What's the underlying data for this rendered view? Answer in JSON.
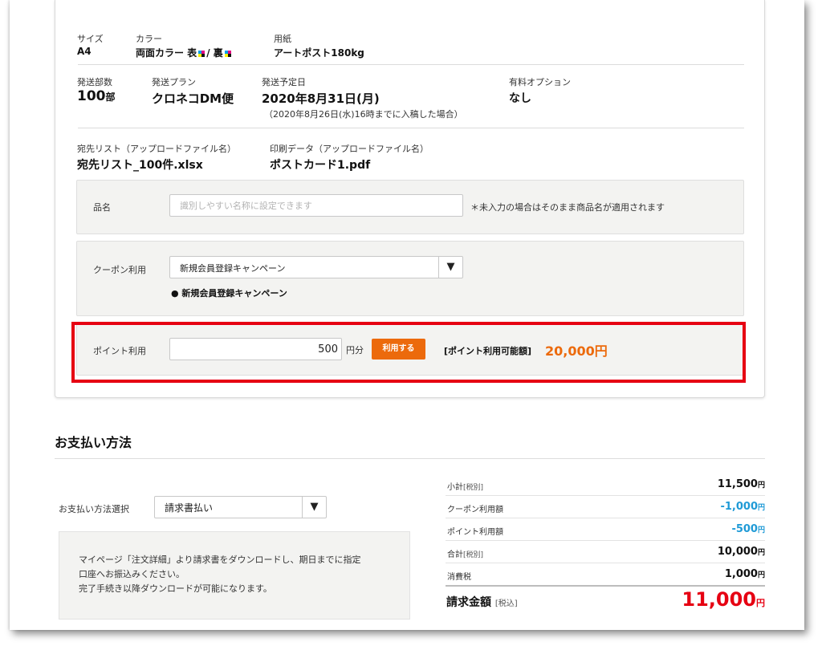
{
  "order": {
    "size_label": "サイズ",
    "size_value": "A4",
    "color_label": "カラー",
    "color_value_a": "両面カラー 表",
    "color_value_sep": "/ 裏",
    "paper_label": "用紙",
    "paper_value": "アートポスト180kg",
    "copies_label": "発送部数",
    "copies_value": "100",
    "copies_unit": "部",
    "plan_label": "発送プラン",
    "plan_value": "クロネコDM便",
    "ship_date_label": "発送予定日",
    "ship_date_value": "2020年8月31日(月)",
    "ship_date_note": "（2020年8月26日(水)16時までに入稿した場合）",
    "option_label": "有料オプション",
    "option_value": "なし",
    "address_list_label": "宛先リスト（アップロードファイル名）",
    "address_list_value": "宛先リスト_100件.xlsx",
    "print_data_label": "印刷データ（アップロードファイル名）",
    "print_data_value": "ポストカード1.pdf"
  },
  "product_name": {
    "label": "品名",
    "placeholder": "識別しやすい名称に設定できます",
    "note": "＊未入力の場合はそのまま商品名が適用されます"
  },
  "coupon": {
    "label": "クーポン利用",
    "selected": "新規会員登録キャンペーン",
    "arrow": "▼",
    "applied": "●  新規会員登録キャンペーン"
  },
  "points": {
    "label": "ポイント利用",
    "value": "500",
    "unit": "円分",
    "button": "利用する",
    "available_label": "[ポイント利用可能額]",
    "available_value": "20,000円"
  },
  "payment": {
    "title": "お支払い方法",
    "select_label": "お支払い方法選択",
    "selected": "請求書払い",
    "arrow": "▼",
    "note_line1": "マイページ「注文詳細」より請求書をダウンロードし、期日までに指定",
    "note_line2": "口座へお振込みください。",
    "note_line3": "完了手続き以降ダウンロードが可能になります。"
  },
  "summary": {
    "subtotal_label": "小計",
    "subtotal_tag": "[税別]",
    "subtotal_value": "11,500",
    "coupon_label": "クーポン利用額",
    "coupon_value": "-1,000",
    "points_label": "ポイント利用額",
    "points_value": "-500",
    "total_label": "合計",
    "total_tag": "[税別]",
    "total_value": "10,000",
    "tax_label": "消費税",
    "tax_value": "1,000",
    "yen": "円",
    "billing_label": "請求金額",
    "billing_tag": "[税込]",
    "billing_value": "11,000"
  },
  "colors": {
    "accent_orange": "#ec6a0c",
    "highlight_red": "#e60012",
    "discount_blue": "#1f9ad6"
  }
}
